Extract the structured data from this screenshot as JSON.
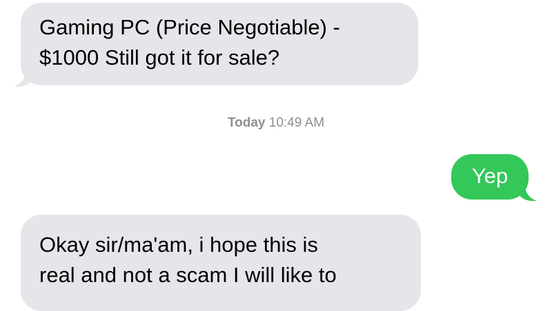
{
  "conversation": {
    "messages": [
      {
        "direction": "incoming",
        "lines": [
          "Gaming PC (Price Negotiable) -",
          "$1000 Still got it for sale?"
        ]
      },
      {
        "direction": "outgoing",
        "text": "Yep"
      },
      {
        "direction": "incoming",
        "lines": [
          "Okay sir/ma'am, i hope this is",
          "real and not a scam I will like to"
        ]
      }
    ],
    "timestamp": {
      "day": "Today",
      "time": "10:49 AM"
    }
  },
  "colors": {
    "incoming_bubble": "#e5e5ea",
    "outgoing_bubble": "#34c759",
    "timestamp_text": "#8e8e93"
  }
}
